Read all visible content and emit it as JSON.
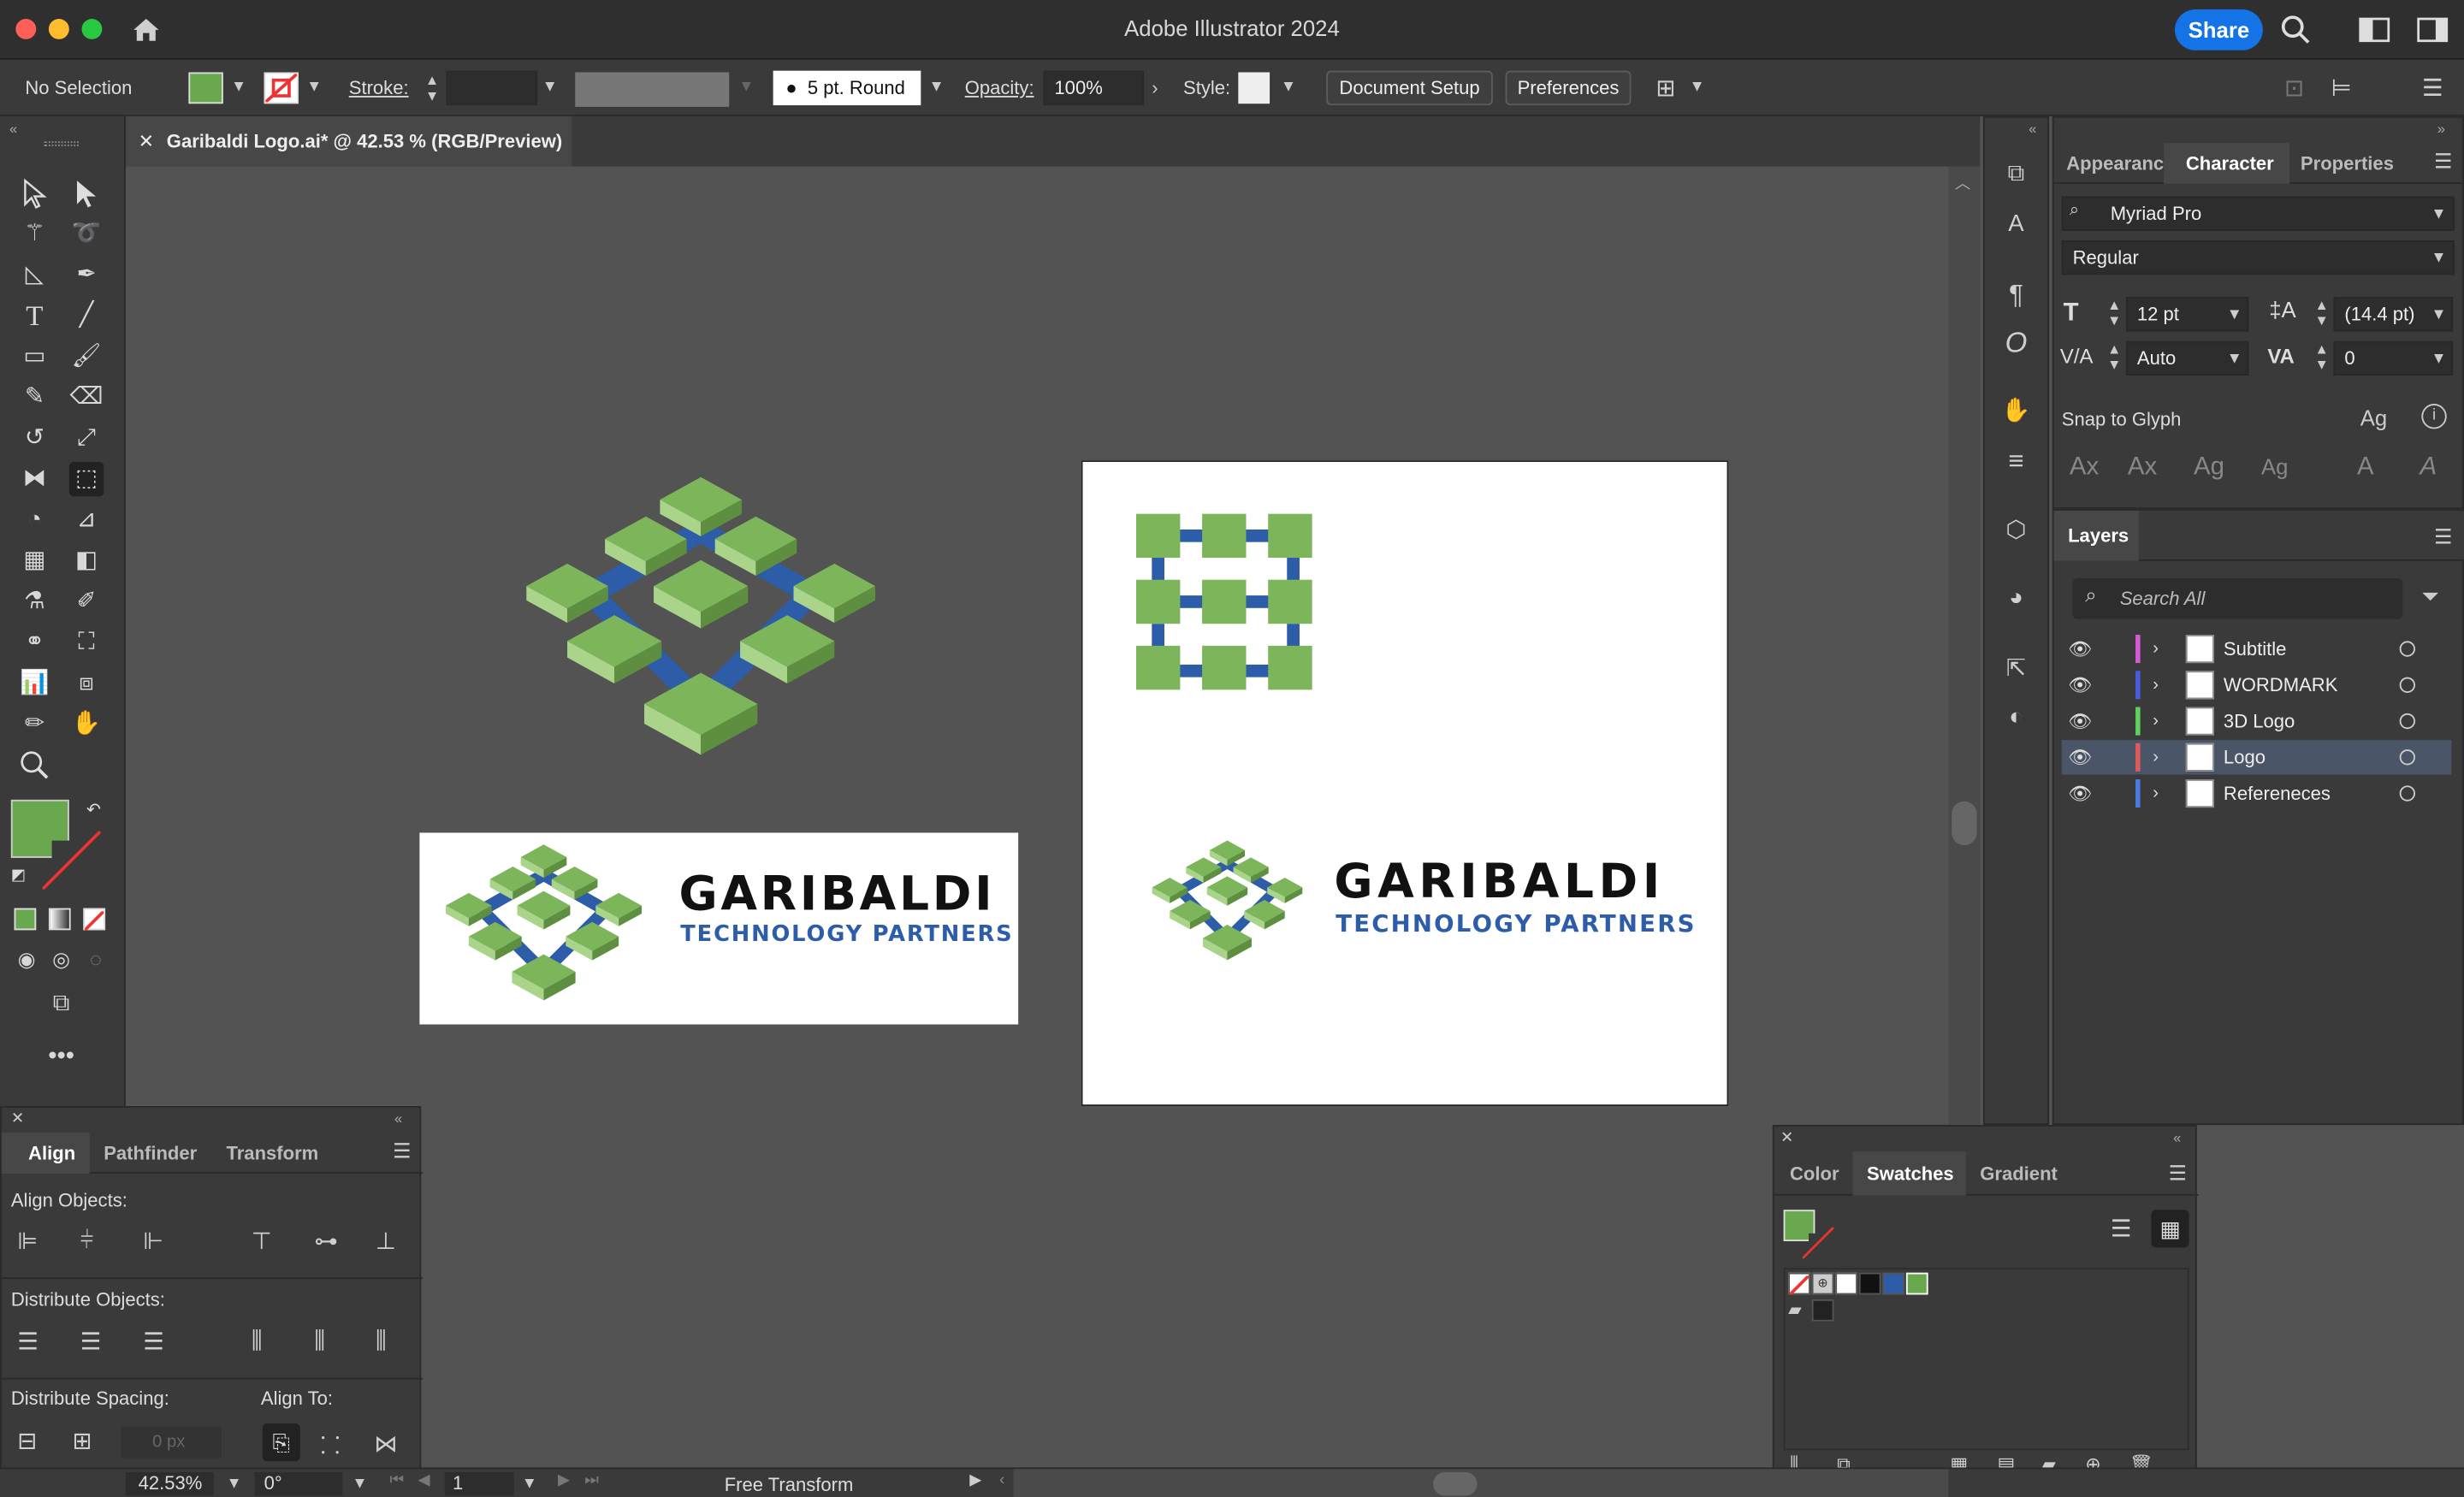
{
  "app": {
    "title": "Adobe Illustrator 2024",
    "share_label": "Share"
  },
  "control_bar": {
    "selection": "No Selection",
    "stroke_label": "Stroke:",
    "brush_label": "5 pt. Round",
    "opacity_label": "Opacity:",
    "opacity_value": "100%",
    "style_label": "Style:",
    "document_setup": "Document Setup",
    "preferences": "Preferences"
  },
  "document_tab": {
    "label": "Garibaldi Logo.ai* @ 42.53 % (RGB/Preview)"
  },
  "artwork": {
    "wordmark": "GARIBALDI",
    "subtitle": "TECHNOLOGY PARTNERS"
  },
  "character_panel": {
    "tabs": [
      "Appearanc",
      "Character",
      "Properties"
    ],
    "font_family": "Myriad Pro",
    "font_style": "Regular",
    "font_size": "12 pt",
    "leading": "(14.4 pt)",
    "kerning": "Auto",
    "tracking": "0",
    "snap_to_glyph": "Snap to Glyph"
  },
  "layers_panel": {
    "title": "Layers",
    "search_placeholder": "Search All",
    "layers": [
      {
        "name": "Subtitle",
        "color": "#d65ad6"
      },
      {
        "name": "WORDMARK",
        "color": "#4a5be0"
      },
      {
        "name": "3D Logo",
        "color": "#5fd15f"
      },
      {
        "name": "Logo",
        "color": "#e05a5a"
      },
      {
        "name": "Refereneces",
        "color": "#4a7be0"
      }
    ]
  },
  "align_panel": {
    "tabs": [
      "Align",
      "Pathfinder",
      "Transform"
    ],
    "align_objects": "Align Objects:",
    "distribute_objects": "Distribute Objects:",
    "distribute_spacing": "Distribute Spacing:",
    "align_to": "Align To:",
    "spacing_value": "0 px"
  },
  "swatches_panel": {
    "tabs": [
      "Color",
      "Swatches",
      "Gradient"
    ]
  },
  "status_bar": {
    "zoom": "42.53%",
    "rotation": "0°",
    "artboard": "1",
    "tool": "Free Transform"
  },
  "colors": {
    "fill": "#6aa84f",
    "accent_blue": "#1473e6",
    "logo_green": "#7cb55a",
    "logo_blue": "#2d5ca8"
  }
}
